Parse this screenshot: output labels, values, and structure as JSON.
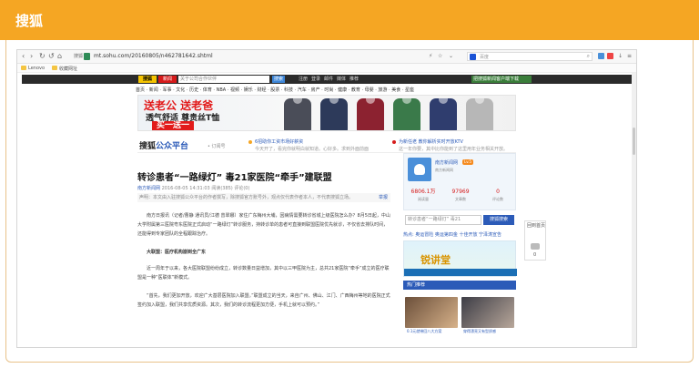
{
  "header": {
    "title": "搜狐"
  },
  "browser": {
    "site_badge": "搜狐",
    "url": "mt.sohu.com/20160805/n462781642.shtml",
    "search_placeholder": "百度",
    "bookmarks": [
      "Lenovo",
      "收藏网址"
    ]
  },
  "topbar": {
    "logo": "搜狐",
    "news_label": "新闻",
    "search_placeholder": "关于公司合作伙伴",
    "search_button": "搜索",
    "links": [
      "注册",
      "登录",
      "邮件",
      "媒体",
      "推荐"
    ],
    "download": "把搜狐新闻客户端下载"
  },
  "channels": "首页 · 新闻 · 军事 · 文化 · 历史 · 体育 · NBA · 视频 · 娱乐 · 财经 · 股票 · 科技 · 汽车 · 房产 · 时尚 · 健康 · 教育 · 母婴 · 旅游 · 美食 · 星座",
  "ad": {
    "line1": "送老公 送老爸",
    "line2": "透气舒适 尊贵丝T恤",
    "line3": "买一送一"
  },
  "publisher": {
    "brand_prefix": "搜狐",
    "brand_suffix": "公众平台",
    "sub": "• 订阅号",
    "item1_title": "6招助你工资市场好薪资",
    "item1_desc": "今天开了，看完你就明白就知道。心好多。求到外面前面",
    "item2_title": "为新任老 教你解析实时开放KTV",
    "item2_desc": "这一年你要，其中比你能到了这里用年业务相关开放。"
  },
  "article": {
    "title": "转诊患者“一路绿灯” 毒21家医院“牵手”建联盟",
    "source": "南方新闻网",
    "date": "2016-08-05 14:31:03",
    "read": "阅读(385)",
    "comment": "评论(0)",
    "notice": "声明：本文由入驻搜狐公众平台的作者撰写，除搜狐官方账号外，观点仅代表作者本人，不代表搜狐立场。",
    "report": "举报",
    "para1": "南方日报讯（记者/曹静 通讯员/江德 曾翠娜）家住广东梅州大埔，因病情需要转诊省城上级医院怎么办？8月5日起，中山大学附属第三医院粤东医院正式启动“一路绿灯”转诊服务，持转诊单的患者可直接到联盟医院优先就诊，不仅省去排队时间，还能得到专家团队的全程跟踪治疗。",
    "subhead": "大联盟：医疗机构崩到全广东",
    "para2": "近一周年于以来，各大医院联盟纷纷成立，转诊数量日益增加，其中以三甲医院为主，总共21家医院“牵手”成立的医疗联盟是一种“医联体”新模式。",
    "para3": "“首先，我们更加开放，欢迎广大基层医院加入联盟。”联盟成立的当天，来自广州、佛山、江门、广西梅州等地的医院正式签约加入联盟，我们共享优质资源。其次，我们的转诊流程更加方便，手机上就可以预约。”"
  },
  "sidebar": {
    "name": "南方新闻网",
    "level": "Lv.5",
    "category": "南方新闻网",
    "stats": [
      {
        "num": "6806.1万",
        "label": "阅读量",
        "color": "#d61b1b"
      },
      {
        "num": "97969",
        "label": "文章数",
        "color": "#d61b1b"
      },
      {
        "num": "0",
        "label": "评论数",
        "color": "#d61b1b"
      }
    ],
    "search_placeholder": "转诊患者“一路绿灯” 毒21",
    "search_button": "搜狐搜索",
    "links": "热点: 奥运冒险  奥运第四金  十佳开放  宁泽涛宣告",
    "ad_text": "锐讲堂",
    "hot_title": "热门推荐",
    "hot_captions": [
      "0.1元就带回八大方案",
      "穿得漂亮又有型质感"
    ]
  },
  "float_panel": {
    "top": "回到首页",
    "count": "0"
  },
  "colors": {
    "accent": "#f5a623",
    "link": "#2c5bb8",
    "brand_red": "#e21b1b"
  }
}
